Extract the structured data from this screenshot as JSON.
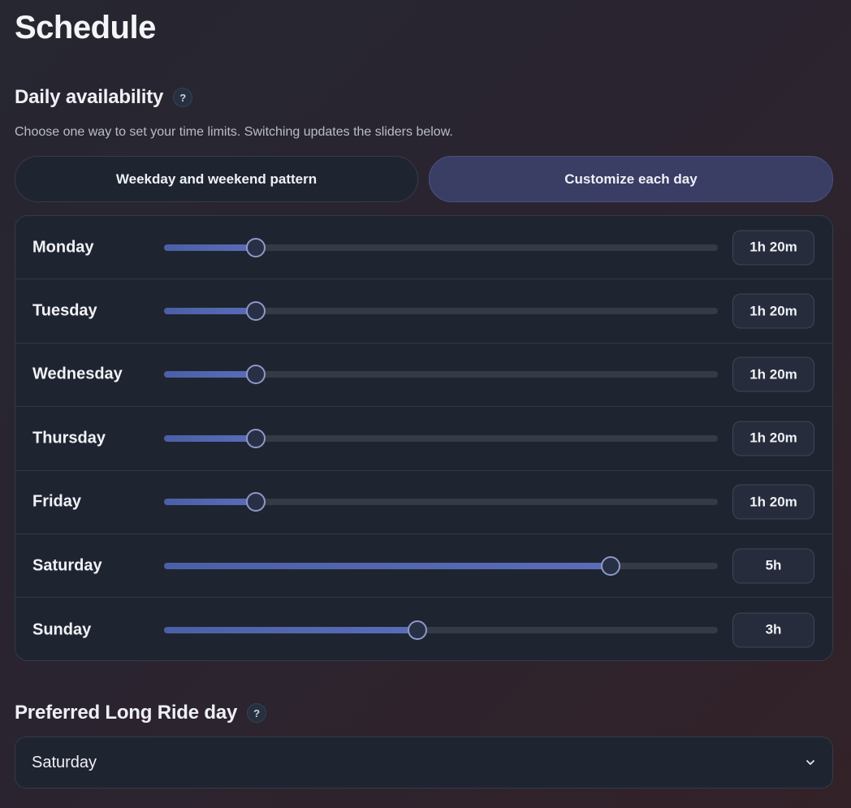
{
  "page": {
    "title": "Schedule"
  },
  "availability": {
    "heading": "Daily availability",
    "help_glyph": "?",
    "subtitle": "Choose one way to set your time limits. Switching updates the sliders below.",
    "modes": [
      {
        "label": "Weekday and weekend pattern",
        "selected": false
      },
      {
        "label": "Customize each day",
        "selected": true
      }
    ],
    "days": [
      {
        "name": "Monday",
        "value": "1h 20m",
        "fraction": 0.165
      },
      {
        "name": "Tuesday",
        "value": "1h 20m",
        "fraction": 0.165
      },
      {
        "name": "Wednesday",
        "value": "1h 20m",
        "fraction": 0.165
      },
      {
        "name": "Thursday",
        "value": "1h 20m",
        "fraction": 0.165
      },
      {
        "name": "Friday",
        "value": "1h 20m",
        "fraction": 0.165
      },
      {
        "name": "Saturday",
        "value": "5h",
        "fraction": 0.807
      },
      {
        "name": "Sunday",
        "value": "3h",
        "fraction": 0.457
      }
    ]
  },
  "long_ride": {
    "heading": "Preferred Long Ride day",
    "help_glyph": "?",
    "selected_day": "Saturday",
    "dropdown_icon": "chevron-down-icon"
  },
  "colors": {
    "accent": "#5a6cb8",
    "selected_mode_bg": "#3a3d64",
    "card_bg": "#1f2431"
  }
}
